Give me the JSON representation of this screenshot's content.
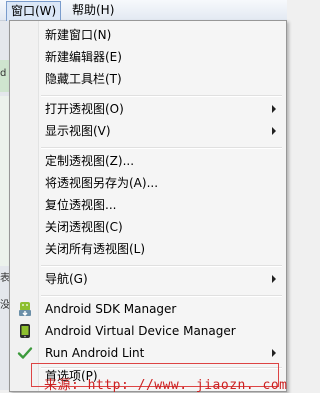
{
  "menubar": {
    "window_menu": "窗口(W)",
    "help_menu": "帮助(H)"
  },
  "background": {
    "strip1": "d",
    "strip2": "表",
    "strip3": "没"
  },
  "menu": {
    "items": [
      {
        "label": "新建窗口(N)"
      },
      {
        "label": "新建编辑器(E)"
      },
      {
        "label": "隐藏工具栏(T)"
      },
      {
        "label": "打开透视图(O)"
      },
      {
        "label": "显示视图(V)"
      },
      {
        "label": "定制透视图(Z)..."
      },
      {
        "label": "将透视图另存为(A)..."
      },
      {
        "label": "复位透视图..."
      },
      {
        "label": "关闭透视图(C)"
      },
      {
        "label": "关闭所有透视图(L)"
      },
      {
        "label": "导航(G)"
      },
      {
        "label": "Android SDK Manager",
        "icon": "android-sdk-icon"
      },
      {
        "label": "Android Virtual Device Manager",
        "icon": "android-avd-icon"
      },
      {
        "label": "Run Android Lint",
        "icon": "check-icon"
      },
      {
        "label": "首选项(P)"
      }
    ]
  },
  "watermark": "来源: http: //www. jiaozn. com",
  "colors": {
    "menu_bg": "#f5f5f5",
    "watermark": "#cc2222",
    "android_green": "#8dbf2e"
  }
}
